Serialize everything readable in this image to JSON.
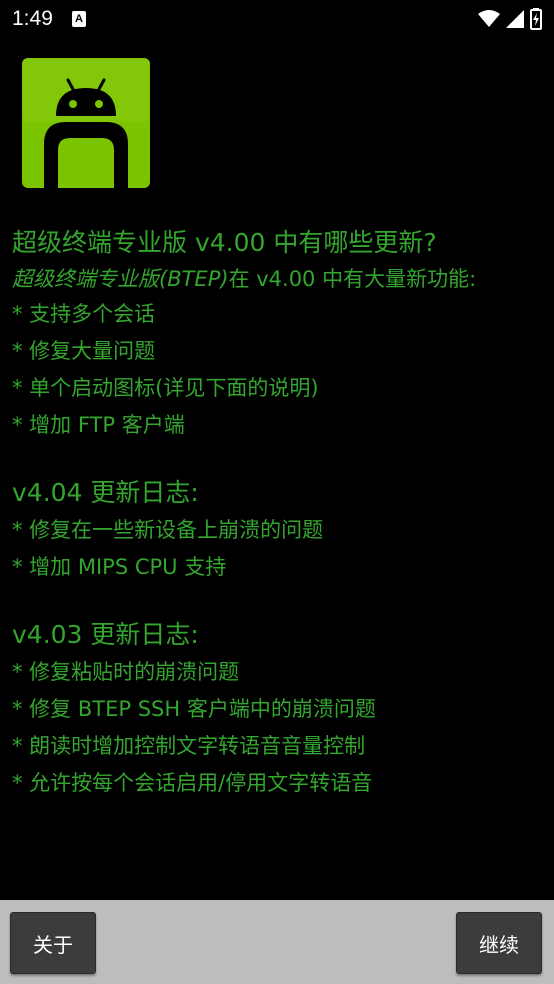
{
  "status_bar": {
    "time": "1:49",
    "notification_badge": "A",
    "icons": [
      "wifi-icon",
      "signal-icon",
      "battery-icon"
    ]
  },
  "app_icon": {
    "name": "android-icon",
    "color": "#7cc400"
  },
  "release_notes": {
    "title": "超级终端专业版 v4.00 中有哪些更新?",
    "intro_italic": "超级终端专业版(BTEP)",
    "intro_rest": "在 v4.00 中有大量新功能:",
    "items": [
      "* 支持多个会话",
      "* 修复大量问题",
      "* 单个启动图标(详见下面的说明)",
      "* 增加 FTP 客户端"
    ]
  },
  "changelog_404": {
    "title": "v4.04 更新日志:",
    "items": [
      "* 修复在一些新设备上崩溃的问题",
      "* 增加 MIPS CPU 支持"
    ]
  },
  "changelog_403": {
    "title": "v4.03 更新日志:",
    "items": [
      "* 修复粘贴时的崩溃问题",
      "* 修复 BTEP SSH 客户端中的崩溃问题",
      "* 朗读时增加控制文字转语音音量控制",
      "* 允许按每个会话启用/停用文字转语音"
    ]
  },
  "buttons": {
    "about": "关于",
    "continue": "继续"
  },
  "colors": {
    "text_green": "#34a52e",
    "background": "#000000",
    "bottom_bar": "#bdbdbd",
    "button": "#3c3c3c"
  }
}
